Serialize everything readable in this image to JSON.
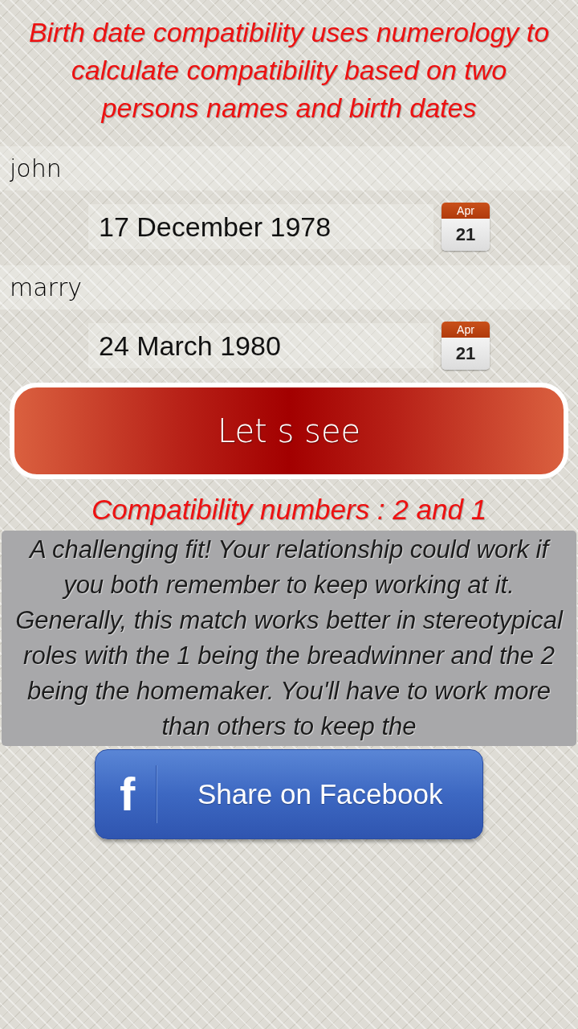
{
  "intro": "Birth date compatibility uses numerology to calculate compatibility based on two persons names and birth dates",
  "persons": [
    {
      "name": "john",
      "birth_date": "17 December 1978",
      "calendar": {
        "month": "Apr",
        "day": "21"
      }
    },
    {
      "name": "marry",
      "birth_date": "24 March 1980",
      "calendar": {
        "month": "Apr",
        "day": "21"
      }
    }
  ],
  "submit_button": {
    "label": "Let s see"
  },
  "result": {
    "numbers": "Compatibility numbers : 2 and 1",
    "description": "A challenging fit! Your relationship could work if you both remember to keep working at it. Generally, this match works better in stereotypical roles with the 1 being the breadwinner and the 2 being the homemaker. You'll have to work more than others to keep the"
  },
  "share_button": {
    "icon": "f",
    "label": "Share on Facebook"
  }
}
